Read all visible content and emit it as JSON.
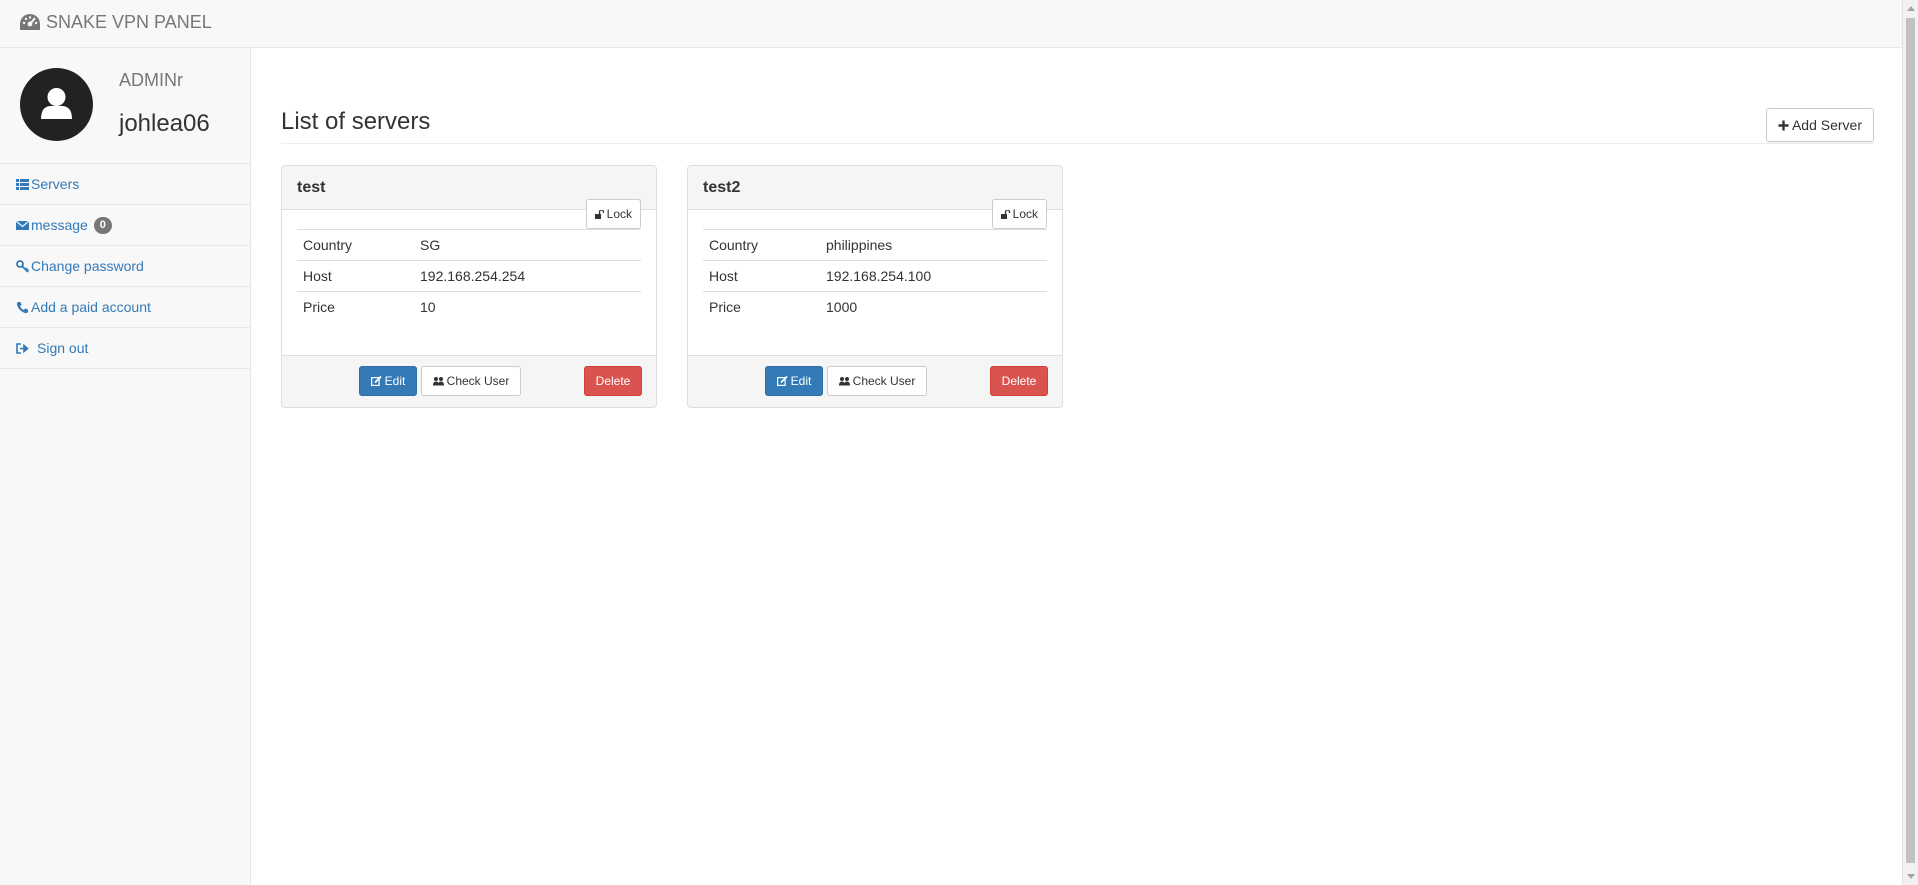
{
  "navbar": {
    "brand": "SNAKE VPN PANEL",
    "brand_icon": "dashboard-icon"
  },
  "profile": {
    "role": "ADMINr",
    "username": "johlea06",
    "avatar_icon": "user-icon"
  },
  "sidebar": {
    "items": [
      {
        "label": "Servers",
        "icon": "list-icon"
      },
      {
        "label": "message",
        "icon": "envelope-icon",
        "badge": "0"
      },
      {
        "label": "Change password",
        "icon": "key-icon"
      },
      {
        "label": "Add a paid account",
        "icon": "phone-icon"
      },
      {
        "label": "Sign out",
        "icon": "log-out-icon"
      }
    ]
  },
  "main": {
    "title": "List of servers",
    "add_button": "Add Server",
    "servers": [
      {
        "name": "test",
        "lock_label": "Lock",
        "rows": [
          {
            "key": "Country",
            "value": "SG"
          },
          {
            "key": "Host",
            "value": "192.168.254.254"
          },
          {
            "key": "Price",
            "value": "10"
          }
        ],
        "edit_label": "Edit",
        "check_label": "Check User",
        "delete_label": "Delete"
      },
      {
        "name": "test2",
        "lock_label": "Lock",
        "rows": [
          {
            "key": "Country",
            "value": "philippines"
          },
          {
            "key": "Host",
            "value": "192.168.254.100"
          },
          {
            "key": "Price",
            "value": "1000"
          }
        ],
        "edit_label": "Edit",
        "check_label": "Check User",
        "delete_label": "Delete"
      }
    ]
  },
  "colors": {
    "primary": "#337ab7",
    "danger": "#d9534f",
    "link": "#337ab7",
    "navbar_bg": "#f8f8f8"
  }
}
